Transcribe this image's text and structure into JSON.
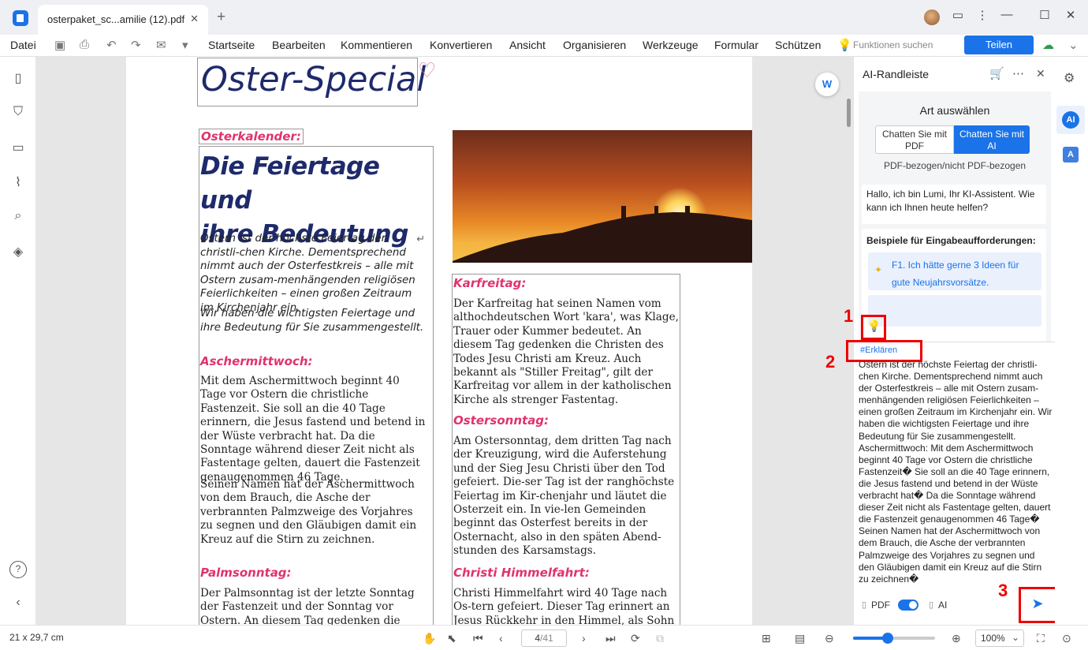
{
  "window": {
    "tab_title": "osterpaket_sc...amilie (12).pdf",
    "tab_close": "✕",
    "new_tab": "+"
  },
  "menu": {
    "file": "Datei",
    "items": [
      "Startseite",
      "Bearbeiten",
      "Kommentieren",
      "Konvertieren",
      "Ansicht",
      "Organisieren",
      "Werkzeuge",
      "Formular",
      "Schützen"
    ],
    "search_features": "Funktionen suchen",
    "share": "Teilen"
  },
  "document": {
    "title": "Oster-Special",
    "calendar_label": "Osterkalender:",
    "main_heading_line1": "Die Feiertage und",
    "main_heading_line2": "ihre Bedeutung",
    "pilcrow": "↵",
    "intro": "Ostern ist der höchste Feiertag der christli-chen Kirche. Dementsprechend nimmt auch der Osterfestkreis – alle mit Ostern zusam-menhängenden religiösen Feierlichkeiten – einen großen Zeitraum im Kirchenjahr ein.",
    "intro2": "Wir haben die wichtigsten Feiertage und ihre Bedeutung für Sie zusammengestellt.",
    "ash_head": "Aschermittwoch:",
    "ash_p1": "Mit dem Aschermittwoch beginnt 40 Tage vor Ostern die christliche Fastenzeit. Sie soll an die 40 Tage erinnern, die Jesus fastend und betend in der Wüste verbracht hat. Da die Sonntage während dieser Zeit nicht als Fastentage gelten, dauert die Fastenzeit genaugenommen 46 Tage.",
    "ash_p2": "Seinen Namen hat der Aschermittwoch von dem Brauch, die Asche der verbrannten Palmzweige des Vorjahres zu segnen und den Gläubigen damit ein Kreuz auf die Stirn zu zeichnen.",
    "palm_head": "Palmsonntag:",
    "palm_p1": "Der Palmsonntag ist der letzte Sonntag der Fastenzeit und der Sonntag vor Ostern. An diesem Tag gedenken die Christen dem Ein-",
    "good_friday_head": "Karfreitag:",
    "good_friday_p": "Der Karfreitag hat seinen Namen vom althochdeutschen Wort 'kara', was Klage, Trauer oder Kummer bedeutet. An diesem Tag gedenken die Christen des Todes Jesu Christi am Kreuz. Auch bekannt als \"Stiller Freitag\", gilt der Karfreitag vor allem in der katholischen Kirche als strenger Fastentag.",
    "easter_head": "Ostersonntag:",
    "easter_p": "Am Ostersonntag, dem dritten Tag nach der Kreuzigung, wird die Auferstehung und der Sieg Jesu Christi über den Tod gefeiert. Die-ser Tag ist der ranghöchste Feiertag im Kir-chenjahr und läutet die Osterzeit ein. In vie-len Gemeinden beginnt das Osterfest bereits in der Osternacht, also in den späten Abend-stunden des Karsamstags.",
    "ascension_head": "Christi Himmelfahrt:",
    "ascension_p": "Christi Himmelfahrt wird 40 Tage nach Os-tern gefeiert. Dieser Tag erinnert an Jesus Rückkehr in den Himmel, als Sohn Gottes an"
  },
  "ai_panel": {
    "title": "AI-Randleiste",
    "mode_label": "Art auswählen",
    "mode_pdf": "Chatten Sie mit PDF",
    "mode_ai": "Chatten Sie mit AI",
    "mode_sub": "PDF-bezogen/nicht PDF-bezogen",
    "greeting": "Hallo, ich bin Lumi, Ihr KI-Assistent. Wie kann ich Ihnen heute helfen?",
    "examples_title": "Beispiele für Eingabeaufforderungen:",
    "example1": "F1. Ich hätte gerne 3 Ideen für gute Neujahrsvorsätze.",
    "tag": "#Erklären",
    "input_text": "Ostern ist der höchste Feiertag der christli-chen Kirche. Dementsprechend nimmt auch der Osterfestkreis – alle mit Ostern zusam-menhängenden religiösen Feierlichkeiten – einen großen Zeitraum im Kirchenjahr ein. Wir haben die wichtigsten Feiertage und ihre Bedeutung für Sie zusammengestellt. Aschermittwoch: Mit dem Aschermittwoch beginnt 40 Tage vor Ostern die christliche Fastenzeit� Sie soll an die 40 Tage erinnern, die Jesus fastend und betend in der Wüste verbracht hat� Da die Sonntage während dieser Zeit nicht als Fastentage gelten, dauert die Fastenzeit genaugenommen 46 Tage� Seinen Namen hat der Aschermittwoch von dem Brauch, die Asche der verbrannten Palmzweige des Vorjahres zu segnen und den Gläubigen damit ein Kreuz auf die Stirn zu zeichnen�",
    "toggle_pdf": "PDF",
    "toggle_ai": "AI",
    "pdf_toggle_on": true,
    "ai_badge": "AI"
  },
  "annotations": {
    "n1": "1",
    "n2": "2",
    "n3": "3"
  },
  "statusbar": {
    "page_size": "21 x 29,7 cm",
    "page_current": "4",
    "page_total": "/41",
    "zoom": "100%",
    "zoom_fraction": 0.42
  },
  "colors": {
    "accent": "#1a73e8",
    "heading_pink": "#e0336e",
    "title_navy": "#1e2a6b",
    "annotation_red": "#ee0000"
  }
}
